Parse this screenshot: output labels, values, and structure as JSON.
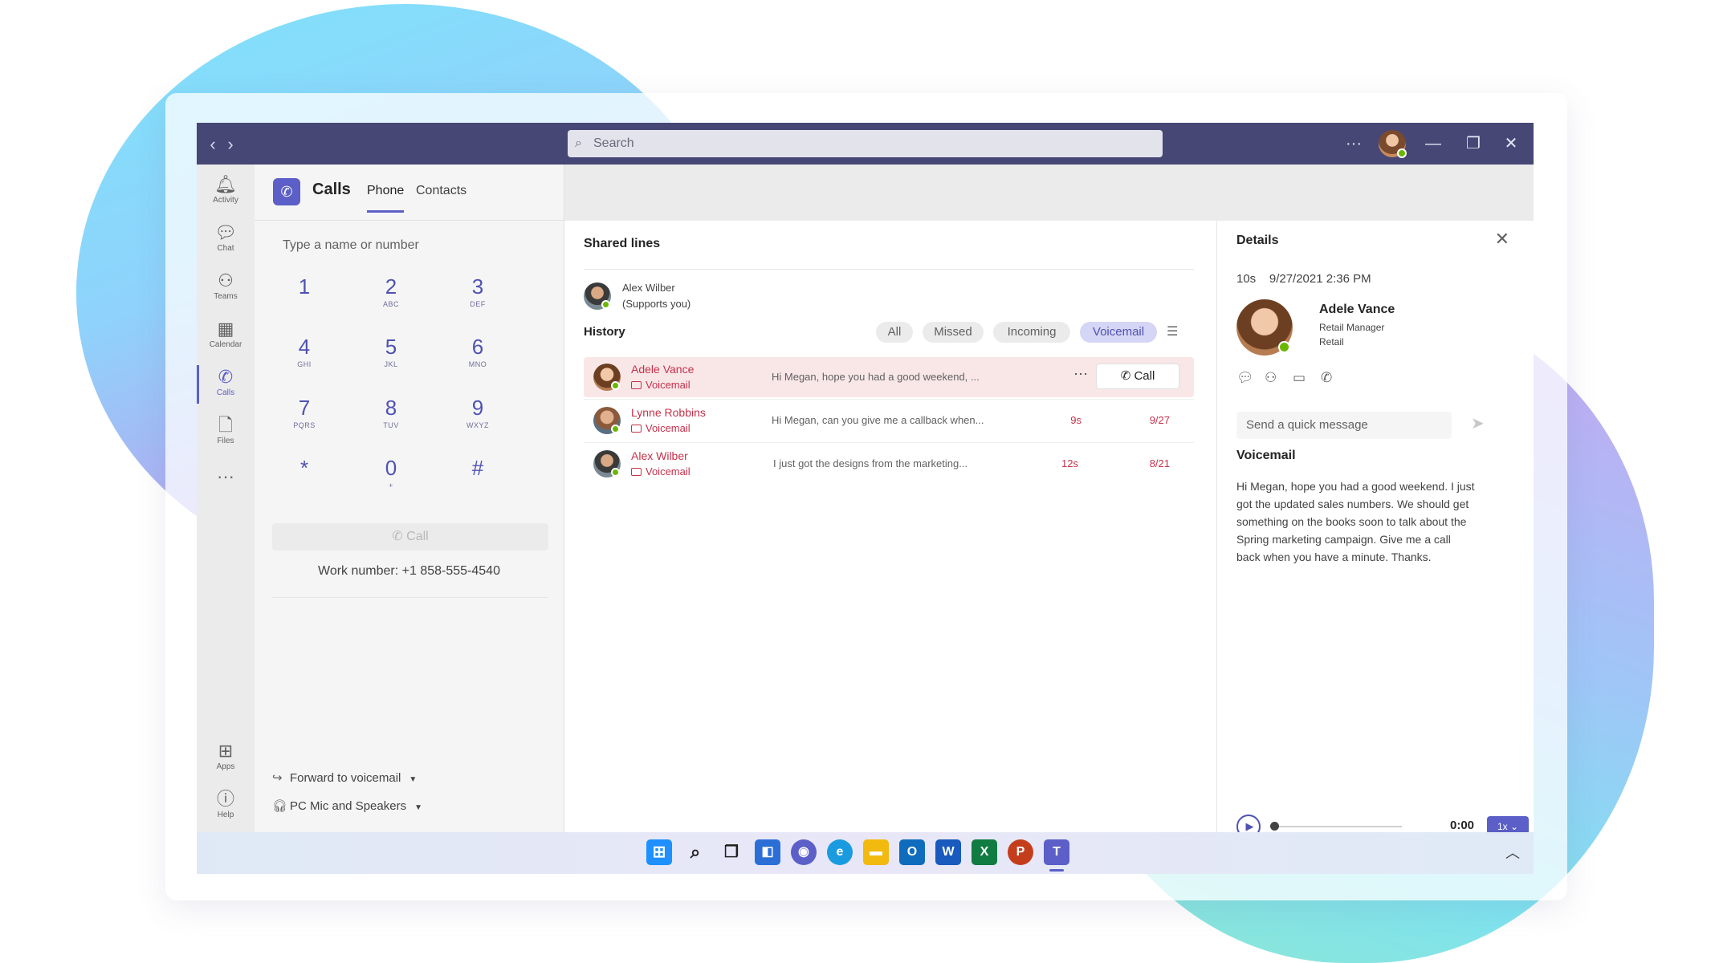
{
  "titlebar": {
    "back": "‹",
    "forward": "›",
    "search_placeholder": "Search",
    "more": "···",
    "minimize": "—",
    "restore": "❐",
    "close": "✕"
  },
  "rail": [
    {
      "label": "Activity",
      "icon": "bell-icon"
    },
    {
      "label": "Chat",
      "icon": "chat-icon"
    },
    {
      "label": "Teams",
      "icon": "teams-icon"
    },
    {
      "label": "Calendar",
      "icon": "calendar-icon"
    },
    {
      "label": "Calls",
      "icon": "phone-icon"
    },
    {
      "label": "Files",
      "icon": "file-icon"
    },
    {
      "label": "···",
      "icon": "more-icon"
    },
    {
      "label": "Apps",
      "icon": "apps-icon"
    },
    {
      "label": "Help",
      "icon": "help-icon"
    }
  ],
  "calls": {
    "title": "Calls",
    "tabs": [
      "Phone",
      "Contacts"
    ],
    "dial_placeholder": "Type a name or number",
    "keys": [
      {
        "n": "1",
        "l": ""
      },
      {
        "n": "2",
        "l": "ABC"
      },
      {
        "n": "3",
        "l": "DEF"
      },
      {
        "n": "4",
        "l": "GHI"
      },
      {
        "n": "5",
        "l": "JKL"
      },
      {
        "n": "6",
        "l": "MNO"
      },
      {
        "n": "7",
        "l": "PQRS"
      },
      {
        "n": "8",
        "l": "TUV"
      },
      {
        "n": "9",
        "l": "WXYZ"
      },
      {
        "n": "*",
        "l": ""
      },
      {
        "n": "0",
        "l": "+"
      },
      {
        "n": "#",
        "l": ""
      }
    ],
    "call_label": "Call",
    "work_number": "Work number: +1 858-555-4540",
    "forward": "Forward to voicemail",
    "device": "PC Mic and Speakers"
  },
  "shared": {
    "heading": "Shared lines",
    "name": "Alex Wilber",
    "note": "(Supports you)"
  },
  "history": {
    "heading": "History",
    "filters": [
      "All",
      "Missed",
      "Incoming",
      "Voicemail"
    ],
    "selected_filter": "Voicemail",
    "rows": [
      {
        "name": "Adele Vance",
        "type": "Voicemail",
        "message": "Hi Megan, hope you had a good weekend, ...",
        "duration": "",
        "date": "",
        "more": "···",
        "call": "Call"
      },
      {
        "name": "Lynne Robbins",
        "type": "Voicemail",
        "message": "Hi Megan, can you give me a callback when...",
        "duration": "9s",
        "date": "9/27"
      },
      {
        "name": "Alex Wilber",
        "type": "Voicemail",
        "message": "I just got the designs from the marketing...",
        "duration": "12s",
        "date": "8/21"
      }
    ]
  },
  "details": {
    "title": "Details",
    "close": "✕",
    "meta": "10s    9/27/2021 2:36 PM",
    "name": "Adele Vance",
    "role": "Retail Manager",
    "dept": "Retail",
    "quick_message_placeholder": "Send a quick message",
    "voicemail_heading": "Voicemail",
    "voicemail_text": "Hi Megan, hope you had a good weekend. I just got the updated sales numbers. We should get something on the books soon to talk about the Spring marketing campaign. Give me a call back when you have a minute. Thanks.",
    "time": "0:00",
    "speed": "1x ⌄",
    "playback_progress": 0
  },
  "colors": {
    "accent": "#5b5fc7",
    "titlebar": "#464775",
    "missed": "#c4314b"
  }
}
